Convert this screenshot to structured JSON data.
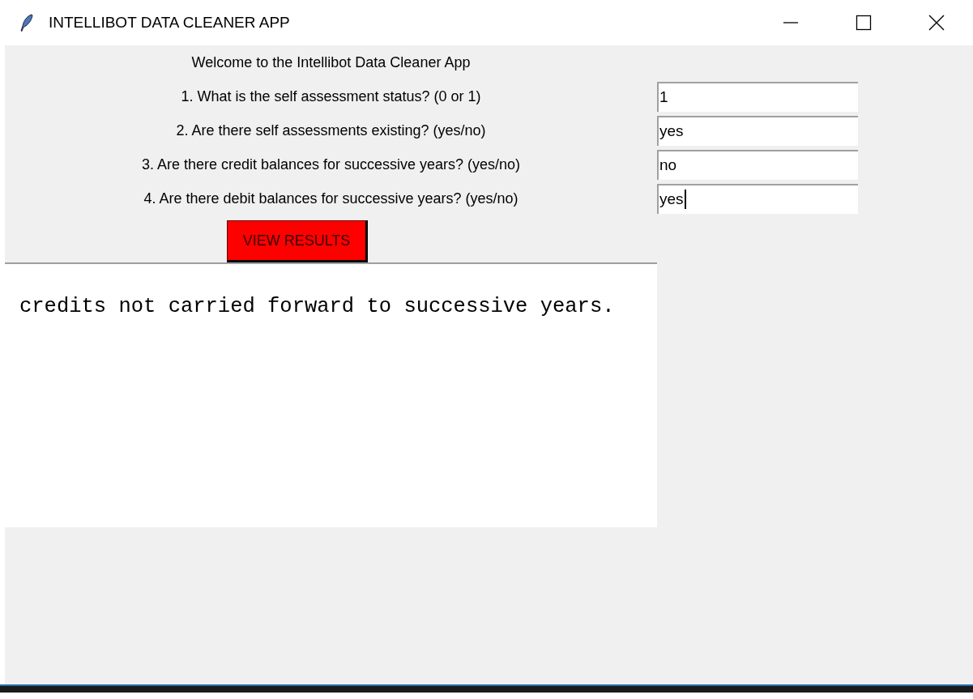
{
  "window": {
    "title": "INTELLIBOT DATA CLEANER APP"
  },
  "heading": "Welcome to the Intellibot Data Cleaner App",
  "questions": [
    {
      "label": "1. What is the self assessment status? (0 or 1)",
      "value": "1",
      "focused": false
    },
    {
      "label": "2. Are there self assessments existing? (yes/no)",
      "value": "yes",
      "focused": false
    },
    {
      "label": "3. Are there credit balances for successive years? (yes/no)",
      "value": "no",
      "focused": false
    },
    {
      "label": "4. Are there debit balances for successive years? (yes/no)",
      "value": "yes",
      "focused": true
    }
  ],
  "button": "VIEW RESULTS",
  "output": "credits not carried forward to successive years."
}
